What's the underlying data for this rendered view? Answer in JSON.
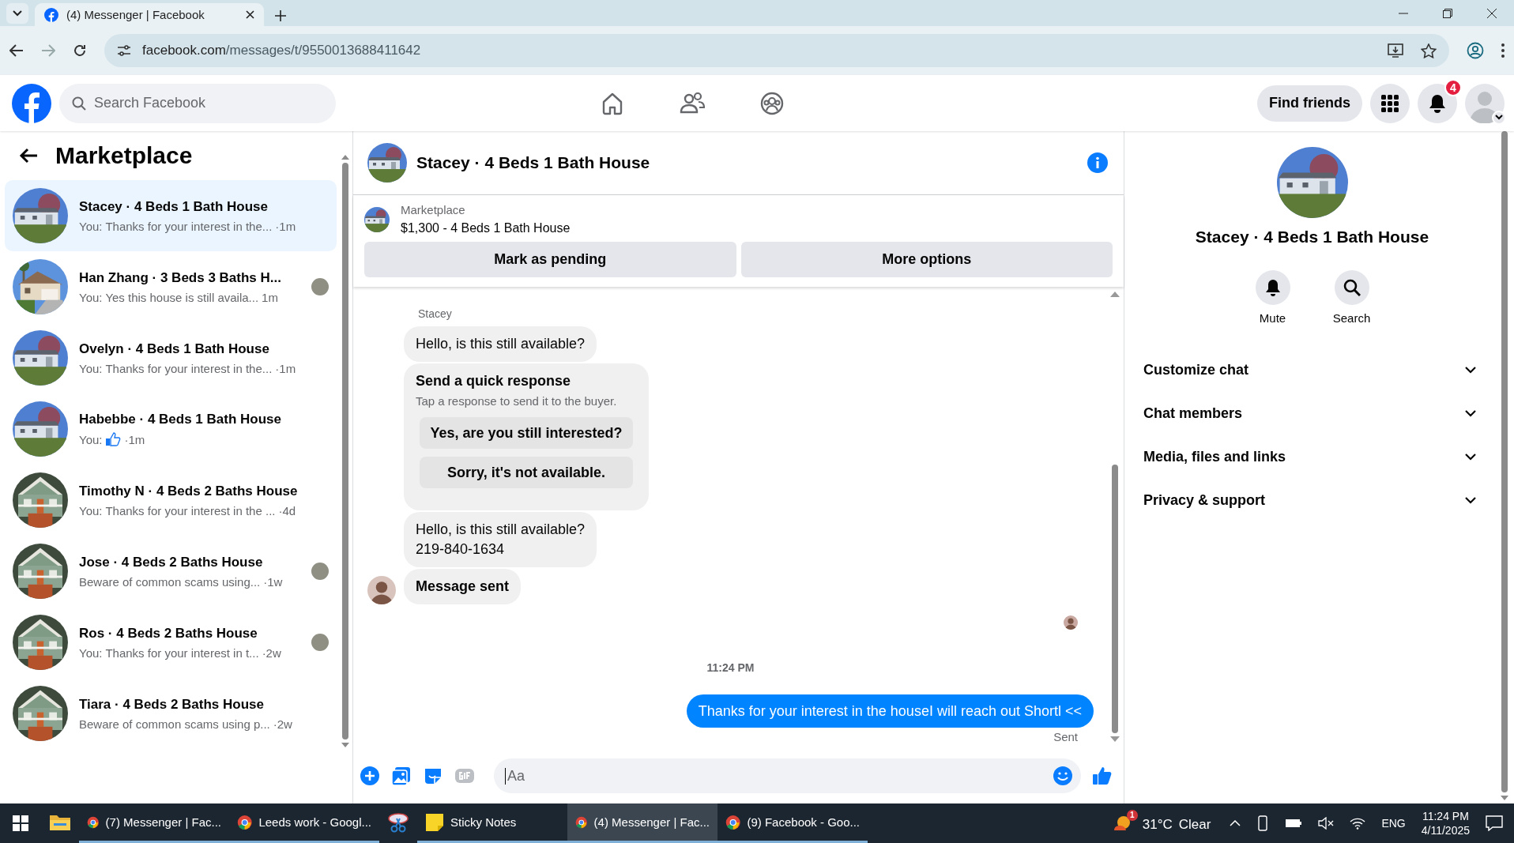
{
  "browser": {
    "tabs": [
      {
        "title": "(4) Messenger | Facebook",
        "selected": true
      }
    ],
    "url_host": "facebook.com",
    "url_path": "/messages/t/9550013688411642"
  },
  "header": {
    "search_placeholder": "Search Facebook",
    "find_friends": "Find friends",
    "notifications_badge": "4"
  },
  "sidebar": {
    "title": "Marketplace",
    "conversations": [
      {
        "title": "Stacey · 4 Beds 1 Bath House",
        "kind": "text",
        "preview": "You: Thanks for your interest in the...",
        "time": "·1m",
        "selected": true,
        "seen": false
      },
      {
        "title": "Han Zhang · 3 Beds 3 Baths H...",
        "kind": "text",
        "preview": "You: Yes this house is still availa...",
        "time": "1m",
        "selected": false,
        "seen": true
      },
      {
        "title": "Ovelyn · 4 Beds 1 Bath House",
        "kind": "text",
        "preview": "You: Thanks for your interest in the...",
        "time": "·1m",
        "selected": false,
        "seen": false
      },
      {
        "title": "Habebbe · 4 Beds 1 Bath House",
        "kind": "like",
        "preview": "You:",
        "time": "·1m",
        "selected": false,
        "seen": false
      },
      {
        "title": "Timothy N · 4 Beds 2 Baths House",
        "kind": "text",
        "preview": "You: Thanks for your interest in the ...",
        "time": "·4d",
        "selected": false,
        "seen": false
      },
      {
        "title": "Jose · 4 Beds 2 Baths House",
        "kind": "text",
        "preview": "Beware of common scams using...",
        "time": "·1w",
        "selected": false,
        "seen": true
      },
      {
        "title": "Ros · 4 Beds 2 Baths House",
        "kind": "text",
        "preview": "You: Thanks for your interest in t...",
        "time": "·2w",
        "selected": false,
        "seen": true
      },
      {
        "title": "Tiara · 4 Beds 2 Baths House",
        "kind": "text",
        "preview": "Beware of common scams using p...",
        "time": "·2w",
        "selected": false,
        "seen": false
      }
    ]
  },
  "chat": {
    "title": "Stacey · 4 Beds 1 Bath House",
    "listing": {
      "source": "Marketplace",
      "title": "$1,300 - 4 Beds 1 Bath House"
    },
    "actions": [
      "Mark as pending",
      "More options"
    ],
    "messages": [
      {
        "kind": "name",
        "text": "Stacey"
      },
      {
        "kind": "incoming",
        "lines": [
          "Hello, is this still available?"
        ]
      },
      {
        "kind": "quick",
        "title": "Send a quick response",
        "hint": "Tap a response to send it to the buyer.",
        "options": [
          "Yes, are you still interested?",
          "Sorry, it's not available."
        ]
      },
      {
        "kind": "incoming",
        "lines": [
          "Hello, is this still available?",
          "219-840-1634"
        ]
      },
      {
        "kind": "system",
        "text": "Message sent"
      },
      {
        "kind": "seen"
      },
      {
        "kind": "time",
        "text": "11:24 PM"
      },
      {
        "kind": "outgoing",
        "text": "Thanks for your interest in the houseI will reach out Shortl <<"
      },
      {
        "kind": "status",
        "text": "Sent"
      }
    ],
    "composer": {
      "placeholder": "Aa"
    }
  },
  "details": {
    "title": "Stacey · 4 Beds 1 Bath House",
    "actions": [
      {
        "kind": "mute",
        "label": "Mute"
      },
      {
        "kind": "search",
        "label": "Search"
      }
    ],
    "sections": [
      {
        "label": "Customize chat",
        "expanded": false
      },
      {
        "label": "Chat members",
        "expanded": false
      },
      {
        "label": "Media, files and links",
        "expanded": false
      },
      {
        "label": "Privacy & support",
        "expanded": false
      }
    ]
  },
  "taskbar": {
    "apps": [
      {
        "kind": "explorer",
        "active": false
      },
      {
        "kind": "chrome",
        "label": "(7) Messenger | Fac...",
        "active": false
      },
      {
        "kind": "chrome",
        "label": "Leeds work - Googl...",
        "active": false
      },
      {
        "kind": "snip",
        "active": false
      },
      {
        "kind": "sticky",
        "label": "Sticky Notes",
        "active": false
      },
      {
        "kind": "chrome",
        "label": "(4) Messenger | Fac...",
        "active": true
      },
      {
        "kind": "chrome",
        "label": "(9) Facebook - Goo...",
        "active": false
      }
    ],
    "weather": {
      "badge": "1",
      "temp": "31°C",
      "condition": "Clear"
    },
    "language": "ENG",
    "time": "11:24 PM",
    "date": "4/11/2025"
  }
}
